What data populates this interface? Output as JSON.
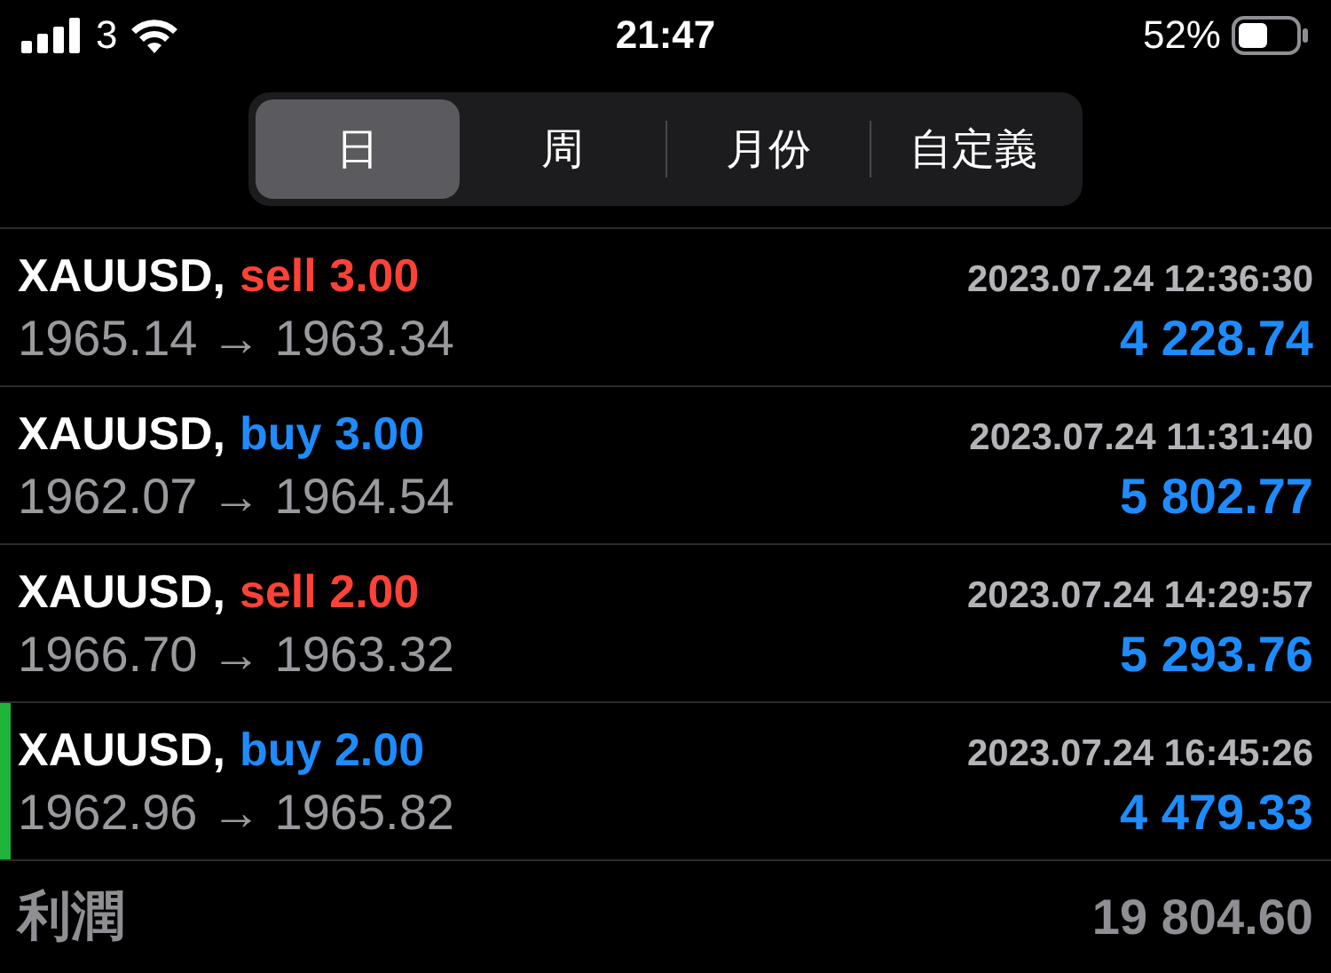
{
  "status_bar": {
    "carrier": "3",
    "time": "21:47",
    "battery": "52%"
  },
  "tabs": [
    {
      "label": "日",
      "selected": true
    },
    {
      "label": "周",
      "selected": false
    },
    {
      "label": "月份",
      "selected": false
    },
    {
      "label": "自定義",
      "selected": false
    }
  ],
  "trades": [
    {
      "symbol": "XAUUSD,",
      "kind": "sell",
      "order": "sell 3.00",
      "time": "2023.07.24 12:36:30",
      "prices": "1965.14 → 1963.34",
      "profit": "4 228.74",
      "selected": false
    },
    {
      "symbol": "XAUUSD,",
      "kind": "buy",
      "order": "buy 3.00",
      "time": "2023.07.24 11:31:40",
      "prices": "1962.07 → 1964.54",
      "profit": "5 802.77",
      "selected": false
    },
    {
      "symbol": "XAUUSD,",
      "kind": "sell",
      "order": "sell 2.00",
      "time": "2023.07.24 14:29:57",
      "prices": "1966.70 → 1963.32",
      "profit": "5 293.76",
      "selected": false
    },
    {
      "symbol": "XAUUSD,",
      "kind": "buy",
      "order": "buy 2.00",
      "time": "2023.07.24 16:45:26",
      "prices": "1962.96 → 1965.82",
      "profit": "4 479.33",
      "selected": true
    }
  ],
  "total": {
    "label": "利潤",
    "value": "19 804.60"
  }
}
